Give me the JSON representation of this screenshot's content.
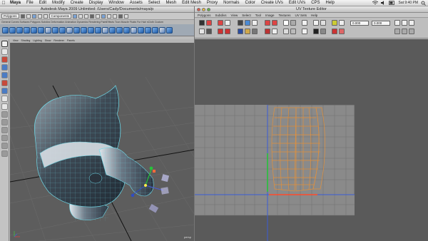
{
  "menubar": {
    "app": "Maya",
    "items": [
      "File",
      "Edit",
      "Modify",
      "Create",
      "Display",
      "Window",
      "Assets",
      "Select",
      "Mesh",
      "Edit Mesh",
      "Proxy",
      "Normals",
      "Color",
      "Create UVs",
      "Edit UVs",
      "CPS",
      "Help"
    ],
    "clock": "Sat 9:40 PM"
  },
  "maya": {
    "title": "Autodesk Maya 2009 Unlimited: /Users/Cady/Documents/maya/p",
    "mode": "Polygons",
    "components_label": "Components",
    "shelf_tabs": [
      "General",
      "Curves",
      "Surfaces",
      "Polygons",
      "Subdivs",
      "Deformation",
      "Animation",
      "Dynamics",
      "Rendering",
      "PaintEffects",
      "Toon",
      "Muscle",
      "Fluids",
      "Fur",
      "Hair",
      "nCloth",
      "Custom"
    ],
    "viewport_menu": [
      "View",
      "Shading",
      "Lighting",
      "Show",
      "Renderer",
      "Panels"
    ],
    "viewport_label": "persp"
  },
  "uv_editor": {
    "title": "UV Texture Editor",
    "menu": [
      "Polygons",
      "Subdivs",
      "View",
      "Select",
      "Tool",
      "Image",
      "Textures",
      "UV Sets",
      "Help"
    ],
    "u_value": "0.000",
    "v_value": "0.000"
  },
  "colors": {
    "uv_shell": "#e0903c",
    "u_axis": "#3a5cd6",
    "v_axis": "#3a5cd6",
    "gizmo_green": "#27c23b",
    "mesh_selection": "#6fd9e8"
  }
}
